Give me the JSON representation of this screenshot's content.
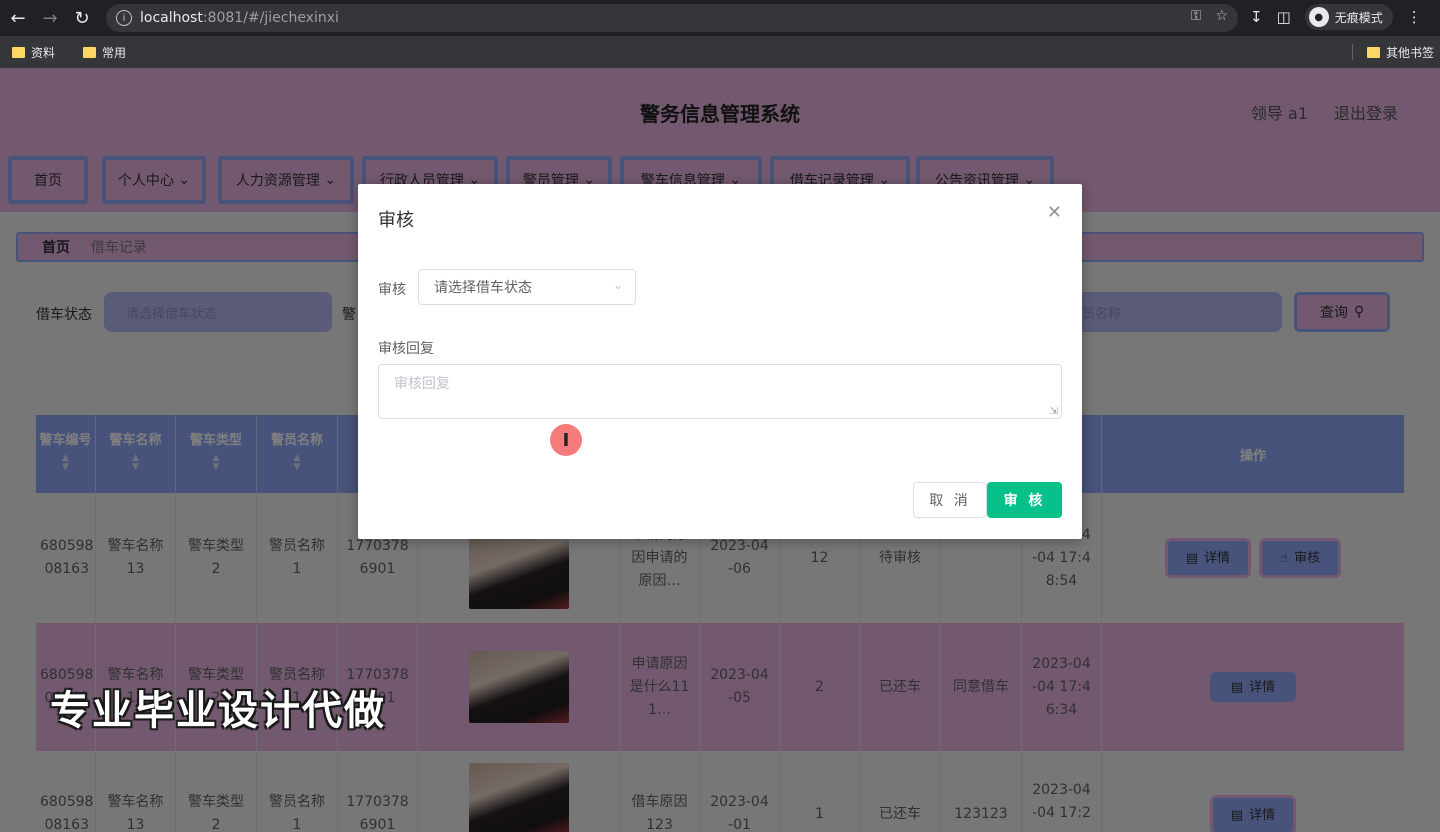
{
  "browser": {
    "url_host": "localhost",
    "url_path": ":8081/#/jiechexinxi",
    "incognito_label": "无痕模式",
    "bookmarks": [
      "资料",
      "常用"
    ],
    "other_bookmarks": "其他书签"
  },
  "header": {
    "title": "警务信息管理系统",
    "user": "领导 a1",
    "logout": "退出登录"
  },
  "menu": [
    "首页",
    "个人中心",
    "人力资源管理",
    "行政人员管理",
    "警员管理",
    "警车信息管理",
    "借车记录管理",
    "公告资讯管理"
  ],
  "breadcrumb": {
    "home": "首页",
    "current": "借车记录"
  },
  "filters": {
    "status_label": "借车状态",
    "status_placeholder": "请选择借车状态",
    "second_label_partial": "警",
    "name_placeholder_partial": "员名称",
    "query_button": "查询"
  },
  "table": {
    "headers": [
      "警车编号",
      "警车名称",
      "警车类型",
      "警员名称",
      "警",
      "",
      "",
      "",
      "",
      "",
      "",
      "间",
      "操作"
    ],
    "rows": [
      {
        "code": "680598\n08163",
        "car_name": "警车名称\n13",
        "car_type": "警车类型\n2",
        "officer": "警员名称\n1",
        "phone": "1770378\n6901",
        "reason": "申请的原\n因申请的\n原因…",
        "date": "2023-04\n-06",
        "days": "12",
        "status": "待审核",
        "reply": "",
        "time": "2023-04\n-04 17:4\n8:54",
        "actions": [
          "详情",
          "审核"
        ]
      },
      {
        "code": "680598\n08163",
        "car_name": "警车名称\n13",
        "car_type": "警车类型\n2",
        "officer": "警员名称\n1",
        "phone": "1770378\n6901",
        "reason": "申请原因\n是什么11\n1…",
        "date": "2023-04\n-05",
        "days": "2",
        "status": "已还车",
        "reply": "同意借车",
        "time": "2023-04\n-04 17:4\n6:34",
        "actions": [
          "详情"
        ]
      },
      {
        "code": "680598\n08163",
        "car_name": "警车名称\n13",
        "car_type": "警车类型\n2",
        "officer": "警员名称\n1",
        "phone": "1770378\n6901",
        "reason": "借车原因\n123",
        "date": "2023-04\n-01",
        "days": "1",
        "status": "已还车",
        "reply": "123123",
        "time": "2023-04\n-04 17:2",
        "actions": [
          "详情"
        ]
      }
    ]
  },
  "dialog": {
    "title": "审核",
    "select_label": "审核",
    "select_placeholder": "请选择借车状态",
    "reply_label": "审核回复",
    "reply_placeholder": "审核回复",
    "cancel": "取 消",
    "confirm": "审 核"
  },
  "watermark": "专业毕业设计代做",
  "colors": {
    "header_bg": "#e6b3df",
    "accent_blue": "#8fa6f5",
    "confirm_green": "#07c08a"
  }
}
